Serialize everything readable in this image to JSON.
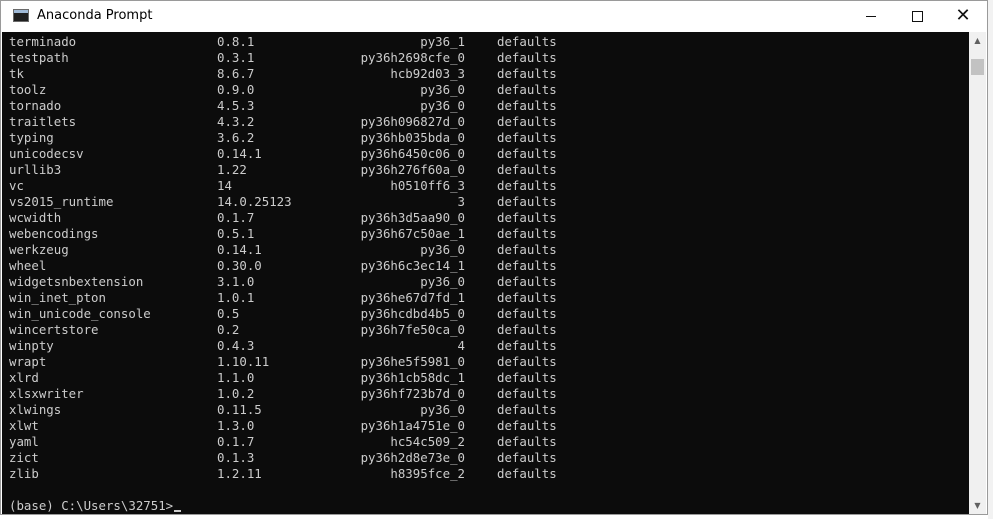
{
  "window": {
    "title": "Anaconda Prompt",
    "buttons": {
      "minimize": "minimize",
      "maximize": "maximize",
      "close": "✕"
    }
  },
  "console": {
    "packages": [
      {
        "name": "terminado",
        "version": "0.8.1",
        "build": "py36_1",
        "channel": "defaults"
      },
      {
        "name": "testpath",
        "version": "0.3.1",
        "build": "py36h2698cfe_0",
        "channel": "defaults"
      },
      {
        "name": "tk",
        "version": "8.6.7",
        "build": "hcb92d03_3",
        "channel": "defaults"
      },
      {
        "name": "toolz",
        "version": "0.9.0",
        "build": "py36_0",
        "channel": "defaults"
      },
      {
        "name": "tornado",
        "version": "4.5.3",
        "build": "py36_0",
        "channel": "defaults"
      },
      {
        "name": "traitlets",
        "version": "4.3.2",
        "build": "py36h096827d_0",
        "channel": "defaults"
      },
      {
        "name": "typing",
        "version": "3.6.2",
        "build": "py36hb035bda_0",
        "channel": "defaults"
      },
      {
        "name": "unicodecsv",
        "version": "0.14.1",
        "build": "py36h6450c06_0",
        "channel": "defaults"
      },
      {
        "name": "urllib3",
        "version": "1.22",
        "build": "py36h276f60a_0",
        "channel": "defaults"
      },
      {
        "name": "vc",
        "version": "14",
        "build": "h0510ff6_3",
        "channel": "defaults"
      },
      {
        "name": "vs2015_runtime",
        "version": "14.0.25123",
        "build": "3",
        "channel": "defaults"
      },
      {
        "name": "wcwidth",
        "version": "0.1.7",
        "build": "py36h3d5aa90_0",
        "channel": "defaults"
      },
      {
        "name": "webencodings",
        "version": "0.5.1",
        "build": "py36h67c50ae_1",
        "channel": "defaults"
      },
      {
        "name": "werkzeug",
        "version": "0.14.1",
        "build": "py36_0",
        "channel": "defaults"
      },
      {
        "name": "wheel",
        "version": "0.30.0",
        "build": "py36h6c3ec14_1",
        "channel": "defaults"
      },
      {
        "name": "widgetsnbextension",
        "version": "3.1.0",
        "build": "py36_0",
        "channel": "defaults"
      },
      {
        "name": "win_inet_pton",
        "version": "1.0.1",
        "build": "py36he67d7fd_1",
        "channel": "defaults"
      },
      {
        "name": "win_unicode_console",
        "version": "0.5",
        "build": "py36hcdbd4b5_0",
        "channel": "defaults"
      },
      {
        "name": "wincertstore",
        "version": "0.2",
        "build": "py36h7fe50ca_0",
        "channel": "defaults"
      },
      {
        "name": "winpty",
        "version": "0.4.3",
        "build": "4",
        "channel": "defaults"
      },
      {
        "name": "wrapt",
        "version": "1.10.11",
        "build": "py36he5f5981_0",
        "channel": "defaults"
      },
      {
        "name": "xlrd",
        "version": "1.1.0",
        "build": "py36h1cb58dc_1",
        "channel": "defaults"
      },
      {
        "name": "xlsxwriter",
        "version": "1.0.2",
        "build": "py36hf723b7d_0",
        "channel": "defaults"
      },
      {
        "name": "xlwings",
        "version": "0.11.5",
        "build": "py36_0",
        "channel": "defaults"
      },
      {
        "name": "xlwt",
        "version": "1.3.0",
        "build": "py36h1a4751e_0",
        "channel": "defaults"
      },
      {
        "name": "yaml",
        "version": "0.1.7",
        "build": "hc54c509_2",
        "channel": "defaults"
      },
      {
        "name": "zict",
        "version": "0.1.3",
        "build": "py36h2d8e73e_0",
        "channel": "defaults"
      },
      {
        "name": "zlib",
        "version": "1.2.11",
        "build": "h8395fce_2",
        "channel": "defaults"
      }
    ],
    "prompt": "(base) C:\\Users\\32751>"
  },
  "colors": {
    "console_background": "#0c0c0c",
    "console_text": "#cccccc",
    "titlebar": "#ffffff"
  }
}
